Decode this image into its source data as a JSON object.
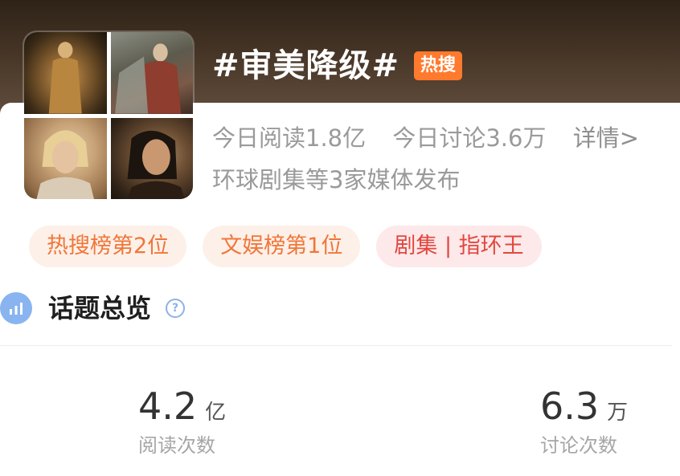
{
  "topic": {
    "title": "#审美降级#",
    "badge": "热搜"
  },
  "stats": {
    "read_today": "今日阅读1.8亿",
    "discuss_today": "今日讨论3.6万",
    "detail_link": "详情>"
  },
  "media_line": "环球剧集等3家媒体发布",
  "tags": [
    {
      "label": "热搜榜第2位",
      "color": "#f0763a"
    },
    {
      "label": "文娱榜第1位",
      "color": "#f0763a"
    },
    {
      "label": "剧集 | 指环王",
      "color": "#e2473f"
    }
  ],
  "overview": {
    "title": "话题总览",
    "help_icon": "question-circle-icon",
    "chart_icon": "bar-chart-icon"
  },
  "metrics": [
    {
      "value": "4.2",
      "unit": "亿",
      "label": "阅读次数"
    },
    {
      "value": "6.3",
      "unit": "万",
      "label": "讨论次数"
    }
  ],
  "colors": {
    "hot_badge": "#ff7a2d",
    "accent_blue": "#8ab4f0"
  }
}
